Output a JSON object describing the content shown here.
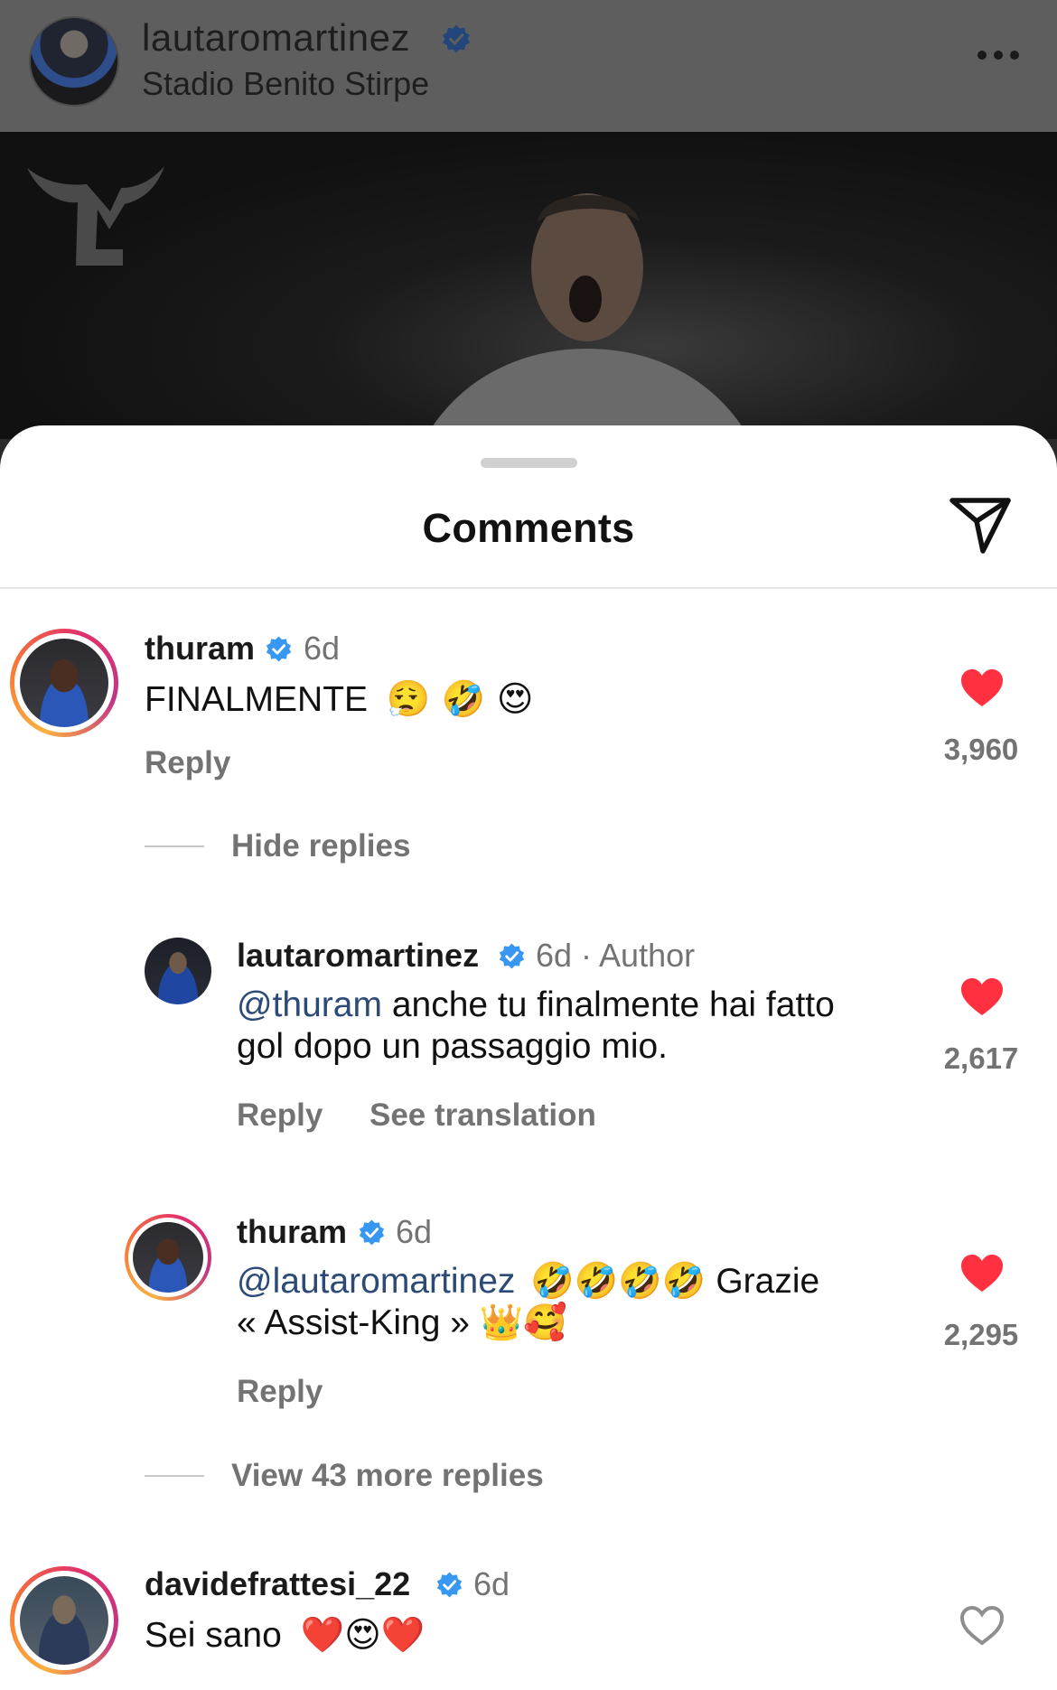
{
  "post": {
    "username": "lautaromartinez",
    "location": "Stadio Benito Stirpe"
  },
  "sheet": {
    "title": "Comments"
  },
  "comments": [
    {
      "username": "thuram",
      "time": "6d",
      "text": "FINALMENTE",
      "emojis": "😮‍💨 🤣 😍",
      "reply_label": "Reply",
      "likes": "3,960",
      "toggle_label": "Hide replies",
      "replies": [
        {
          "username": "lautaromartinez",
          "meta": "6d · Author",
          "mention": "@thuram",
          "text_line1": " anche tu finalmente hai fatto",
          "text_line2": "gol dopo un passaggio mio.",
          "reply_label": "Reply",
          "translate_label": "See translation",
          "likes": "2,617"
        },
        {
          "username": "thuram",
          "meta": "6d",
          "mention": "@lautaromartinez",
          "emojis_line1": "🤣🤣🤣🤣",
          "text_line1": " Grazie",
          "text_line2": "« Assist-King » ",
          "emojis_line2": "👑🥰",
          "reply_label": "Reply",
          "likes": "2,295"
        }
      ],
      "more_replies_label": "View 43 more replies"
    },
    {
      "username": "davidefrattesi_22",
      "time": "6d",
      "text": "Sei sano",
      "emojis": "❤️😍❤️"
    }
  ],
  "colors": {
    "like_red": "#ff3040",
    "verified_blue": "#3897f0",
    "mention_blue": "#2c4a78"
  }
}
